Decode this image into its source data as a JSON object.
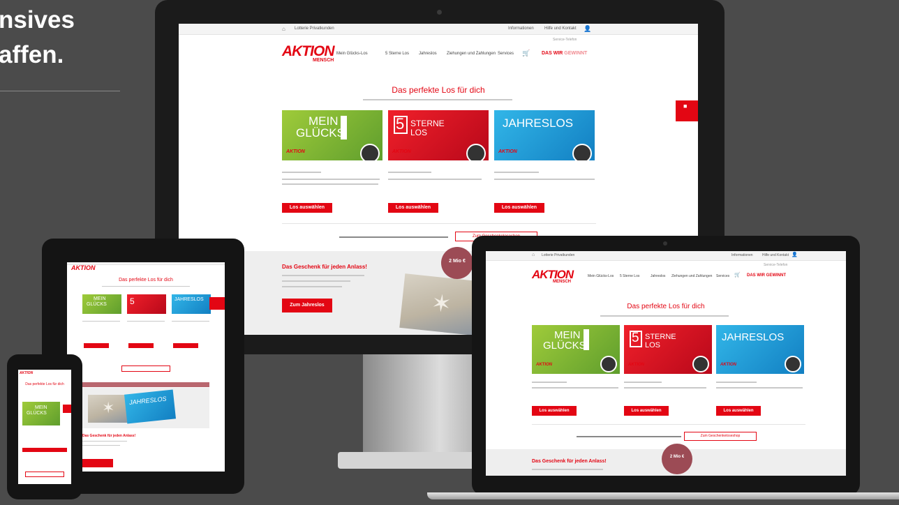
{
  "heading": {
    "line1": "nsives",
    "line2": "affen."
  },
  "site": {
    "topbar": {
      "brand_label": "Lotterie Privatkunden",
      "info_label": "Informationen",
      "help_label": "Hilfe und Kontakt",
      "service_label": "Service-Telefon"
    },
    "logo": {
      "main": "AKTION",
      "sub": "MENSCH"
    },
    "nav": [
      "Mein Glücks-Los",
      "5 Sterne Los",
      "Jahreslos",
      "Ziehungen und Zahlungen",
      "Services"
    ],
    "nav_highlight": {
      "left": "DAS WIR ",
      "right": "GEWINNT"
    },
    "hero_title": "Das perfekte Los für dich",
    "tickets": [
      {
        "name": "MEIN GLÜCKS-LOS",
        "line1": "MEIN",
        "line2": "GLÜCKS",
        "tag": "LOS",
        "color": "#7bb431"
      },
      {
        "name": "5 STERNE LOS",
        "number": "5",
        "line1": "STERNE",
        "line2": "LOS",
        "color": "#e30613"
      },
      {
        "name": "JAHRESLOS",
        "line1": "JAHRESLOS",
        "color": "#1f9ad8"
      }
    ],
    "choose_button": "Los auswählen",
    "gift_shop_button": "Zum Geschenkeloseshop",
    "gift_title": "Das Geschenk für jeden Anlass!",
    "gift_button": "Zum Jahreslos",
    "promo_badge": "2 Mio €",
    "tablet_banner_ticket": "JAHRESLOS"
  },
  "colors": {
    "brand_red": "#e30613",
    "green": "#7bb431",
    "blue": "#1f9ad8",
    "background": "#4b4b4b"
  }
}
